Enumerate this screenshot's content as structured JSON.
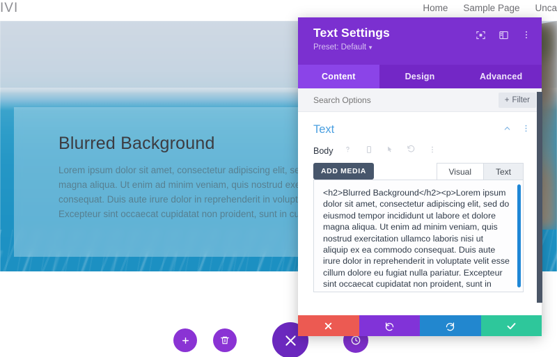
{
  "site": {
    "logo": "IVI",
    "nav": [
      "Home",
      "Sample Page",
      "Unca"
    ],
    "hero": {
      "heading": "Blurred Background",
      "paragraph": "Lorem ipsum dolor sit amet, consectetur adipiscing elit, sed do eiusmod tempor incididunt ut labore et dolore magna aliqua. Ut enim ad minim veniam, quis nostrud exercitation ullamco laboris nisi ut aliquip ex ea commodo consequat. Duis aute irure dolor in reprehenderit in voluptate velit esse cillum dolore eu fugiat nulla pariatur. Excepteur sint occaecat cupidatat non proident, sunt in culpa qui officia deserunt mollit anim id est laborum."
    },
    "fabs": [
      {
        "name": "add-module-button",
        "icon": "plus-icon"
      },
      {
        "name": "delete-module-button",
        "icon": "trash-icon"
      },
      {
        "name": "close-builder-button",
        "icon": "close-icon"
      },
      {
        "name": "history-button",
        "icon": "clock-icon"
      }
    ]
  },
  "modal": {
    "title": "Text Settings",
    "preset_label": "Preset: Default",
    "header_icons": [
      "focus-icon",
      "layout-panel-icon",
      "more-vertical-icon"
    ],
    "tabs": [
      {
        "label": "Content",
        "active": true
      },
      {
        "label": "Design",
        "active": false
      },
      {
        "label": "Advanced",
        "active": false
      }
    ],
    "search_placeholder": "Search Options",
    "filter_label": "Filter",
    "section": {
      "title": "Text",
      "icons": [
        "chevron-up-icon",
        "more-vertical-icon"
      ]
    },
    "field": {
      "label": "Body",
      "icons": [
        "help-icon",
        "responsive-icon",
        "hover-icon",
        "reset-icon",
        "more-vertical-icon"
      ]
    },
    "editor": {
      "add_media_label": "ADD MEDIA",
      "editor_tabs": [
        {
          "label": "Visual",
          "active": false
        },
        {
          "label": "Text",
          "active": true
        }
      ],
      "content": "<h2>Blurred Background</h2><p>Lorem ipsum dolor sit amet, consectetur adipiscing elit, sed do eiusmod tempor incididunt ut labore et dolore magna aliqua. Ut enim ad minim veniam, quis nostrud exercitation ullamco laboris nisi ut aliquip ex ea commodo consequat. Duis aute irure dolor in reprehenderit in voluptate velit esse cillum dolore eu fugiat nulla pariatur. Excepteur sint occaecat cupidatat non proident, sunt in"
    },
    "footer": [
      {
        "name": "cancel-button",
        "icon": "x-icon",
        "color": "#ec5a52"
      },
      {
        "name": "undo-button",
        "icon": "undo-icon",
        "color": "#8133d8"
      },
      {
        "name": "redo-button",
        "icon": "redo-icon",
        "color": "#2287cf"
      },
      {
        "name": "save-button",
        "icon": "check-icon",
        "color": "#2ec79b"
      }
    ]
  },
  "colors": {
    "header_purple": "#7B30D0",
    "tabbar_purple": "#7327C6",
    "active_tab_purple": "#8B44E8",
    "section_blue": "#4a9fe0",
    "scrollbar_blue": "#1f87d6"
  }
}
